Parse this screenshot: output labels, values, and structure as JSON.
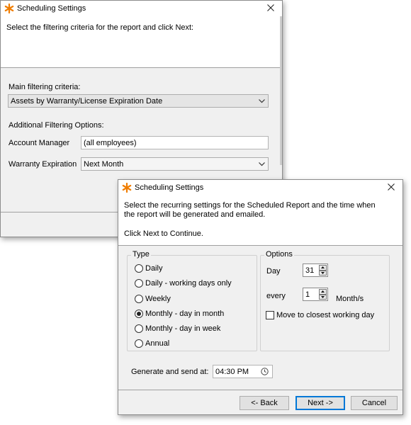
{
  "colors": {
    "icon_orange": "#f07d00",
    "default_button_border": "#0078d7"
  },
  "window1": {
    "title": "Scheduling Settings",
    "instruction": "Select the filtering criteria for the report and click Next:",
    "main_filter_label": "Main filtering criteria:",
    "main_filter_value": "Assets by Warranty/License Expiration Date",
    "additional_label": "Additional Filtering Options:",
    "account_manager_label": "Account Manager",
    "account_manager_value": "(all employees)",
    "warranty_label": "Warranty Expiration",
    "warranty_value": "Next Month"
  },
  "window2": {
    "title": "Scheduling Settings",
    "instruction_line1": "Select the recurring settings for the Scheduled Report and the time when",
    "instruction_line2": "the report will be generated and emailed.",
    "instruction_line3": "Click Next to Continue.",
    "type_group": {
      "legend": "Type",
      "options": [
        "Daily",
        "Daily - working days only",
        "Weekly",
        "Monthly - day in month",
        "Monthly - day in week",
        "Annual"
      ],
      "selected": "Monthly - day in month"
    },
    "options_group": {
      "legend": "Options",
      "day_label": "Day",
      "day_value": "31",
      "every_label": "every",
      "every_value": "1",
      "month_unit": "Month/s",
      "closest_checkbox_label": "Move to closest working day",
      "closest_checked": false
    },
    "generate_label": "Generate and send at:",
    "time_value": "04:30 PM",
    "buttons": {
      "back": "<- Back",
      "next": "Next ->",
      "cancel": "Cancel"
    }
  }
}
